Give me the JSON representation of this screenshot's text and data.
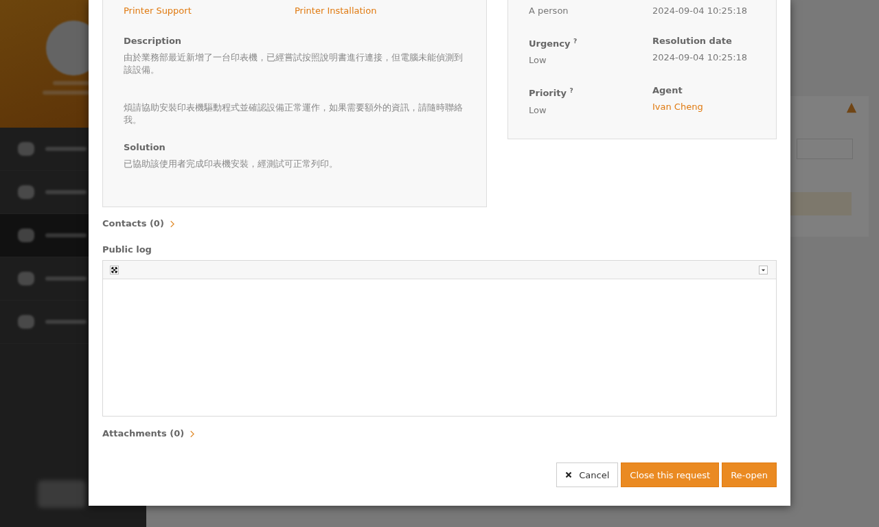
{
  "background_sidebar": {
    "items": [
      {
        "selected": false
      },
      {
        "selected": false
      },
      {
        "selected": true
      },
      {
        "selected": false
      },
      {
        "selected": false
      }
    ]
  },
  "request_form": {
    "left_panel": {
      "top_row": [
        "Printer Support",
        "Printer Installation"
      ],
      "sections": [
        {
          "label": "Description",
          "paragraphs": [
            "由於業務部最近新增了一台印表機，已經嘗試按照說明書進行連接，但電腦未能偵測到該設備。",
            "煩請協助安裝印表機驅動程式並確認設備正常運作，如果需要額外的資訊，請隨時聯絡我。"
          ]
        },
        {
          "label": "Solution",
          "paragraphs": [
            "已協助該使用者完成印表機安裝，經測試可正常列印。"
          ]
        }
      ]
    },
    "right_panel": {
      "fields": [
        {
          "kind": "value",
          "value": "A person"
        },
        {
          "kind": "value",
          "value": "2024-09-04 10:25:18"
        },
        {
          "kind": "field",
          "label": "Urgency $^{?}$",
          "value": "Low"
        },
        {
          "kind": "field",
          "label": "Resolution date",
          "value": "2024-09-04 10:25:18"
        },
        {
          "kind": "field",
          "label": "Priority $^{?}$",
          "value": "Low"
        },
        {
          "kind": "link",
          "label": "Agent",
          "value": "Ivan Cheng"
        }
      ]
    },
    "contacts": {
      "label": "Contacts",
      "count": "(0)"
    },
    "public_log": {
      "label": "Public log"
    },
    "attachments": {
      "label": "Attachments",
      "count": "(0)"
    },
    "buttons": [
      {
        "kind": "cancel",
        "label": "Cancel"
      },
      {
        "kind": "primary",
        "label": "Close this request"
      },
      {
        "kind": "primary",
        "label": "Re-open"
      }
    ]
  }
}
